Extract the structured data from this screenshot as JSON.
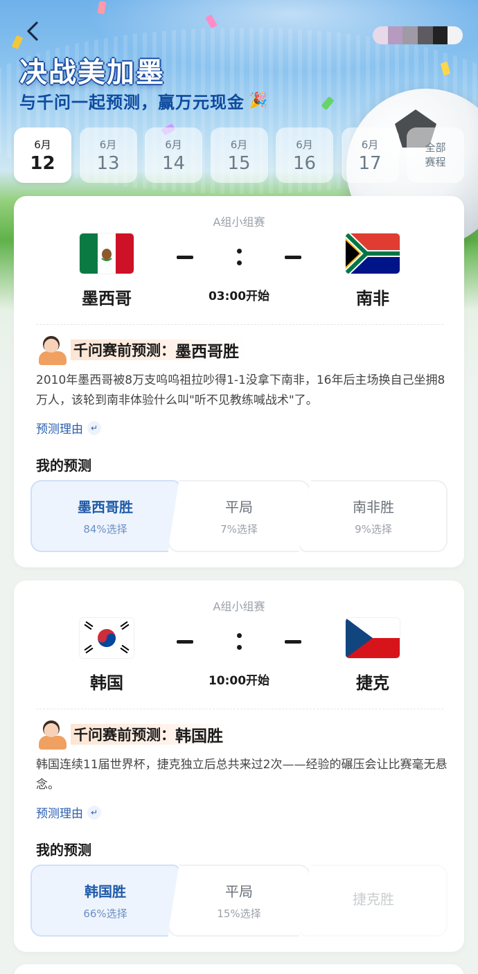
{
  "header": {
    "title": "决战美加墨",
    "subtitle": "与千问一起预测，赢万元现金",
    "subtitle_icon": "party-popper-icon"
  },
  "date_tabs": [
    {
      "month": "6月",
      "day": "12",
      "active": true
    },
    {
      "month": "6月",
      "day": "13",
      "active": false
    },
    {
      "month": "6月",
      "day": "14",
      "active": false
    },
    {
      "month": "6月",
      "day": "15",
      "active": false
    },
    {
      "month": "6月",
      "day": "16",
      "active": false
    },
    {
      "month": "6月",
      "day": "17",
      "active": false
    }
  ],
  "all_schedule": {
    "line1": "全部",
    "line2": "赛程"
  },
  "matches": [
    {
      "stage": "A组小组赛",
      "home": {
        "name": "墨西哥",
        "flag": "mexico-flag"
      },
      "away": {
        "name": "南非",
        "flag": "south-africa-flag"
      },
      "kickoff": "03:00开始",
      "ai_label": "千问赛前预测：",
      "ai_pick": "墨西哥胜",
      "analysis": "2010年墨西哥被8万支呜呜祖拉吵得1-1没拿下南非，16年后主场换自己坐拥8万人，该轮到南非体验什么叫\"听不见教练喊战术\"了。",
      "reason_link": "预测理由",
      "my_prediction_title": "我的预测",
      "options": [
        {
          "label": "墨西哥胜",
          "pct": "84%选择",
          "selected": true
        },
        {
          "label": "平局",
          "pct": "7%选择",
          "selected": false
        },
        {
          "label": "南非胜",
          "pct": "9%选择",
          "selected": false
        }
      ]
    },
    {
      "stage": "A组小组赛",
      "home": {
        "name": "韩国",
        "flag": "korea-flag"
      },
      "away": {
        "name": "捷克",
        "flag": "czech-flag"
      },
      "kickoff": "10:00开始",
      "ai_label": "千问赛前预测：",
      "ai_pick": "韩国胜",
      "analysis": "韩国连续11届世界杯，捷克独立后总共来过2次——经验的碾压会让比赛毫无悬念。",
      "reason_link": "预测理由",
      "my_prediction_title": "我的预测",
      "options": [
        {
          "label": "韩国胜",
          "pct": "66%选择",
          "selected": true
        },
        {
          "label": "平局",
          "pct": "15%选择",
          "selected": false
        },
        {
          "label": "捷克胜",
          "pct": "",
          "selected": false
        }
      ]
    }
  ],
  "colors": {
    "title_outline": "#1b4fa3",
    "subtitle": "#0e4a9e",
    "link": "#2a5db0",
    "selected_bg": "#eef4fd",
    "selected_text": "#1e5aa8"
  }
}
